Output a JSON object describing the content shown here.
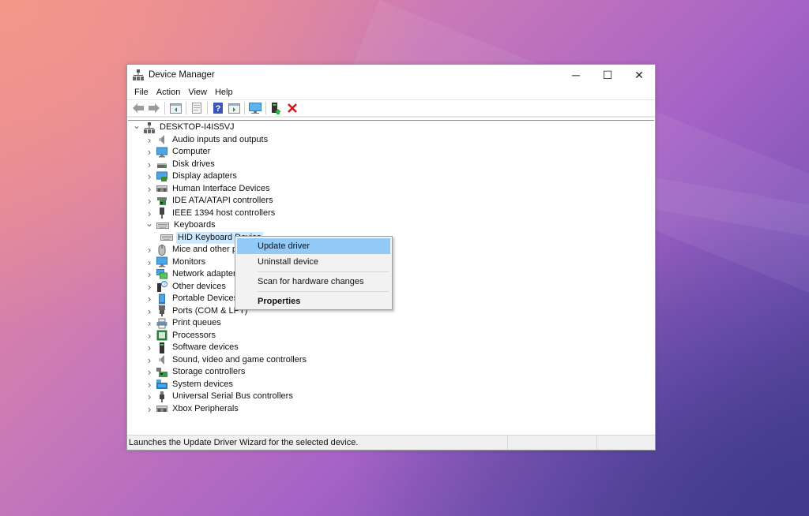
{
  "window": {
    "title": "Device Manager",
    "controls": {
      "minimize": "─",
      "maximize": "☐",
      "close": "✕"
    }
  },
  "menu": [
    "File",
    "Action",
    "View",
    "Help"
  ],
  "toolbar": [
    {
      "icon": "back-arrow-icon"
    },
    {
      "icon": "forward-arrow-icon"
    },
    {
      "sep": true
    },
    {
      "icon": "show-hide-console-tree-icon"
    },
    {
      "sep": true
    },
    {
      "icon": "properties-icon"
    },
    {
      "sep": true
    },
    {
      "icon": "help-icon"
    },
    {
      "icon": "action-pane-icon"
    },
    {
      "sep": true
    },
    {
      "icon": "scan-hardware-icon"
    },
    {
      "sep": true
    },
    {
      "icon": "update-driver-icon"
    },
    {
      "icon": "uninstall-icon"
    }
  ],
  "tree": {
    "root": {
      "label": "DESKTOP-I4IS5VJ",
      "expanded": true
    },
    "nodes": [
      {
        "label": "Audio inputs and outputs",
        "icon": "speaker-icon",
        "expanded": false
      },
      {
        "label": "Computer",
        "icon": "monitor-icon",
        "expanded": false
      },
      {
        "label": "Disk drives",
        "icon": "disk-drive-icon",
        "expanded": false
      },
      {
        "label": "Display adapters",
        "icon": "display-adapter-icon",
        "expanded": false
      },
      {
        "label": "Human Interface Devices",
        "icon": "hid-icon",
        "expanded": false
      },
      {
        "label": "IDE ATA/ATAPI controllers",
        "icon": "ide-controller-icon",
        "expanded": false
      },
      {
        "label": "IEEE 1394 host controllers",
        "icon": "ieee1394-icon",
        "expanded": false
      },
      {
        "label": "Keyboards",
        "icon": "keyboard-icon",
        "expanded": true
      },
      {
        "label": "HID Keyboard Device",
        "icon": "keyboard-icon",
        "child": true,
        "selected": true
      },
      {
        "label": "Mice and other pointing devices",
        "icon": "mouse-icon",
        "expanded": false
      },
      {
        "label": "Monitors",
        "icon": "monitor-icon",
        "expanded": false
      },
      {
        "label": "Network adapters",
        "icon": "network-adapter-icon",
        "expanded": false
      },
      {
        "label": "Other devices",
        "icon": "unknown-device-icon",
        "expanded": false
      },
      {
        "label": "Portable Devices",
        "icon": "portable-device-icon",
        "expanded": false
      },
      {
        "label": "Ports (COM & LPT)",
        "icon": "port-icon",
        "expanded": false
      },
      {
        "label": "Print queues",
        "icon": "printer-icon",
        "expanded": false
      },
      {
        "label": "Processors",
        "icon": "processor-icon",
        "expanded": false
      },
      {
        "label": "Software devices",
        "icon": "software-device-icon",
        "expanded": false
      },
      {
        "label": "Sound, video and game controllers",
        "icon": "speaker-icon",
        "expanded": false
      },
      {
        "label": "Storage controllers",
        "icon": "storage-controller-icon",
        "expanded": false
      },
      {
        "label": "System devices",
        "icon": "system-device-icon",
        "expanded": false
      },
      {
        "label": "Universal Serial Bus controllers",
        "icon": "usb-icon",
        "expanded": false
      },
      {
        "label": "Xbox Peripherals",
        "icon": "hid-icon",
        "expanded": false
      }
    ]
  },
  "context_menu": {
    "items": [
      {
        "label": "Update driver",
        "hover": true
      },
      {
        "label": "Uninstall device"
      },
      {
        "sep": true
      },
      {
        "label": "Scan for hardware changes"
      },
      {
        "sep": true
      },
      {
        "label": "Properties",
        "bold": true
      }
    ]
  },
  "status": {
    "text": "Launches the Update Driver Wizard for the selected device."
  },
  "colors": {
    "selection": "#cce8ff",
    "menu_hover": "#91c9f7",
    "uninstall_red": "#d11a1a"
  }
}
